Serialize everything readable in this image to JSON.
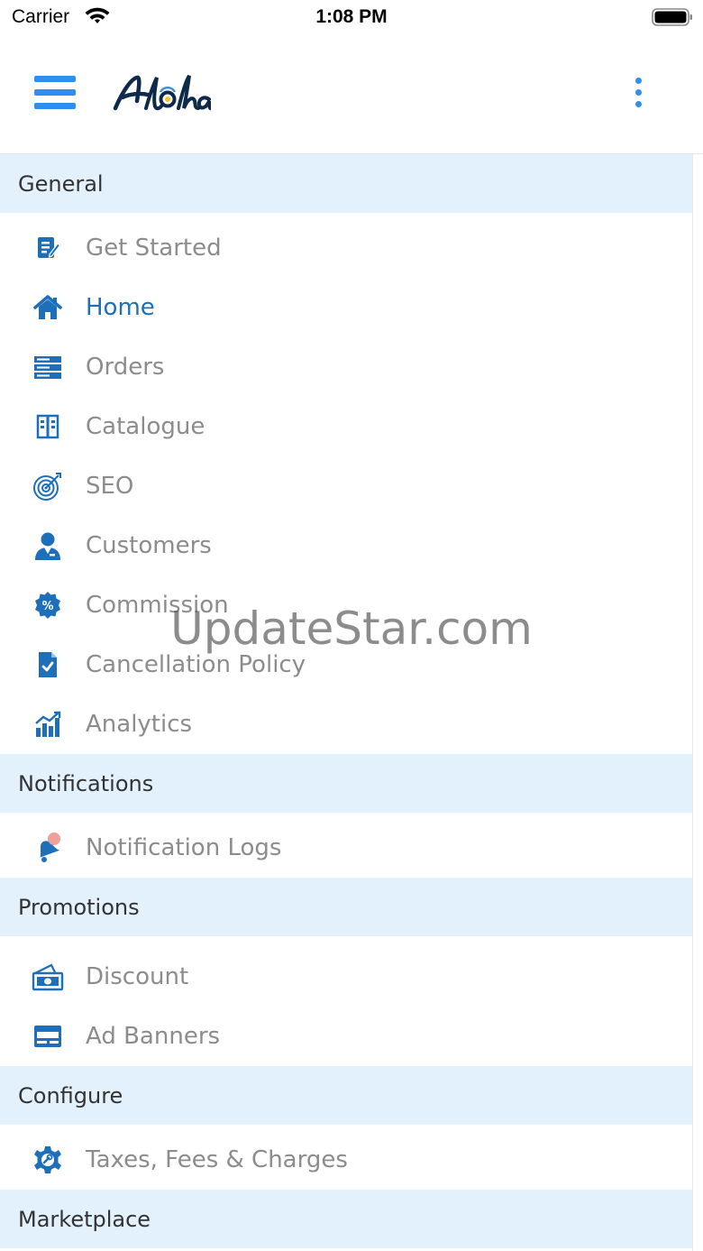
{
  "status_bar": {
    "carrier": "Carrier",
    "time": "1:08 PM"
  },
  "header": {
    "logo_text": "Aloha",
    "menu_icon": "hamburger-icon",
    "more_icon": "vertical-dots-icon",
    "accent_color": "#2f8ff0"
  },
  "menu": {
    "general": {
      "title": "General",
      "items": [
        {
          "label": "Get Started",
          "icon": "edit-document-icon"
        },
        {
          "label": "Home",
          "icon": "home-icon",
          "active": true
        },
        {
          "label": "Orders",
          "icon": "orders-list-icon"
        },
        {
          "label": "Catalogue",
          "icon": "catalogue-book-icon"
        },
        {
          "label": "SEO",
          "icon": "target-icon"
        },
        {
          "label": "Customers",
          "icon": "customer-icon"
        },
        {
          "label": "Commission",
          "icon": "percent-badge-icon"
        },
        {
          "label": "Cancellation Policy",
          "icon": "document-check-icon"
        },
        {
          "label": "Analytics",
          "icon": "bar-chart-icon"
        }
      ]
    },
    "notifications": {
      "title": "Notifications",
      "items": [
        {
          "label": "Notification Logs",
          "icon": "bell-icon"
        }
      ]
    },
    "promotions": {
      "title": "Promotions",
      "items": [
        {
          "label": "Discount",
          "icon": "cash-icon"
        },
        {
          "label": "Ad Banners",
          "icon": "banner-icon"
        }
      ]
    },
    "configure": {
      "title": "Configure",
      "items": [
        {
          "label": "Taxes, Fees & Charges",
          "icon": "gear-icon"
        }
      ]
    },
    "marketplace": {
      "title": "Marketplace"
    }
  },
  "watermark": "UpdateStar.com",
  "colors": {
    "section_bg": "#e3f1fd",
    "active_text": "#1c6fb8",
    "icon_blue": "#1c6fb8",
    "inactive_text": "#8c8c8c"
  }
}
